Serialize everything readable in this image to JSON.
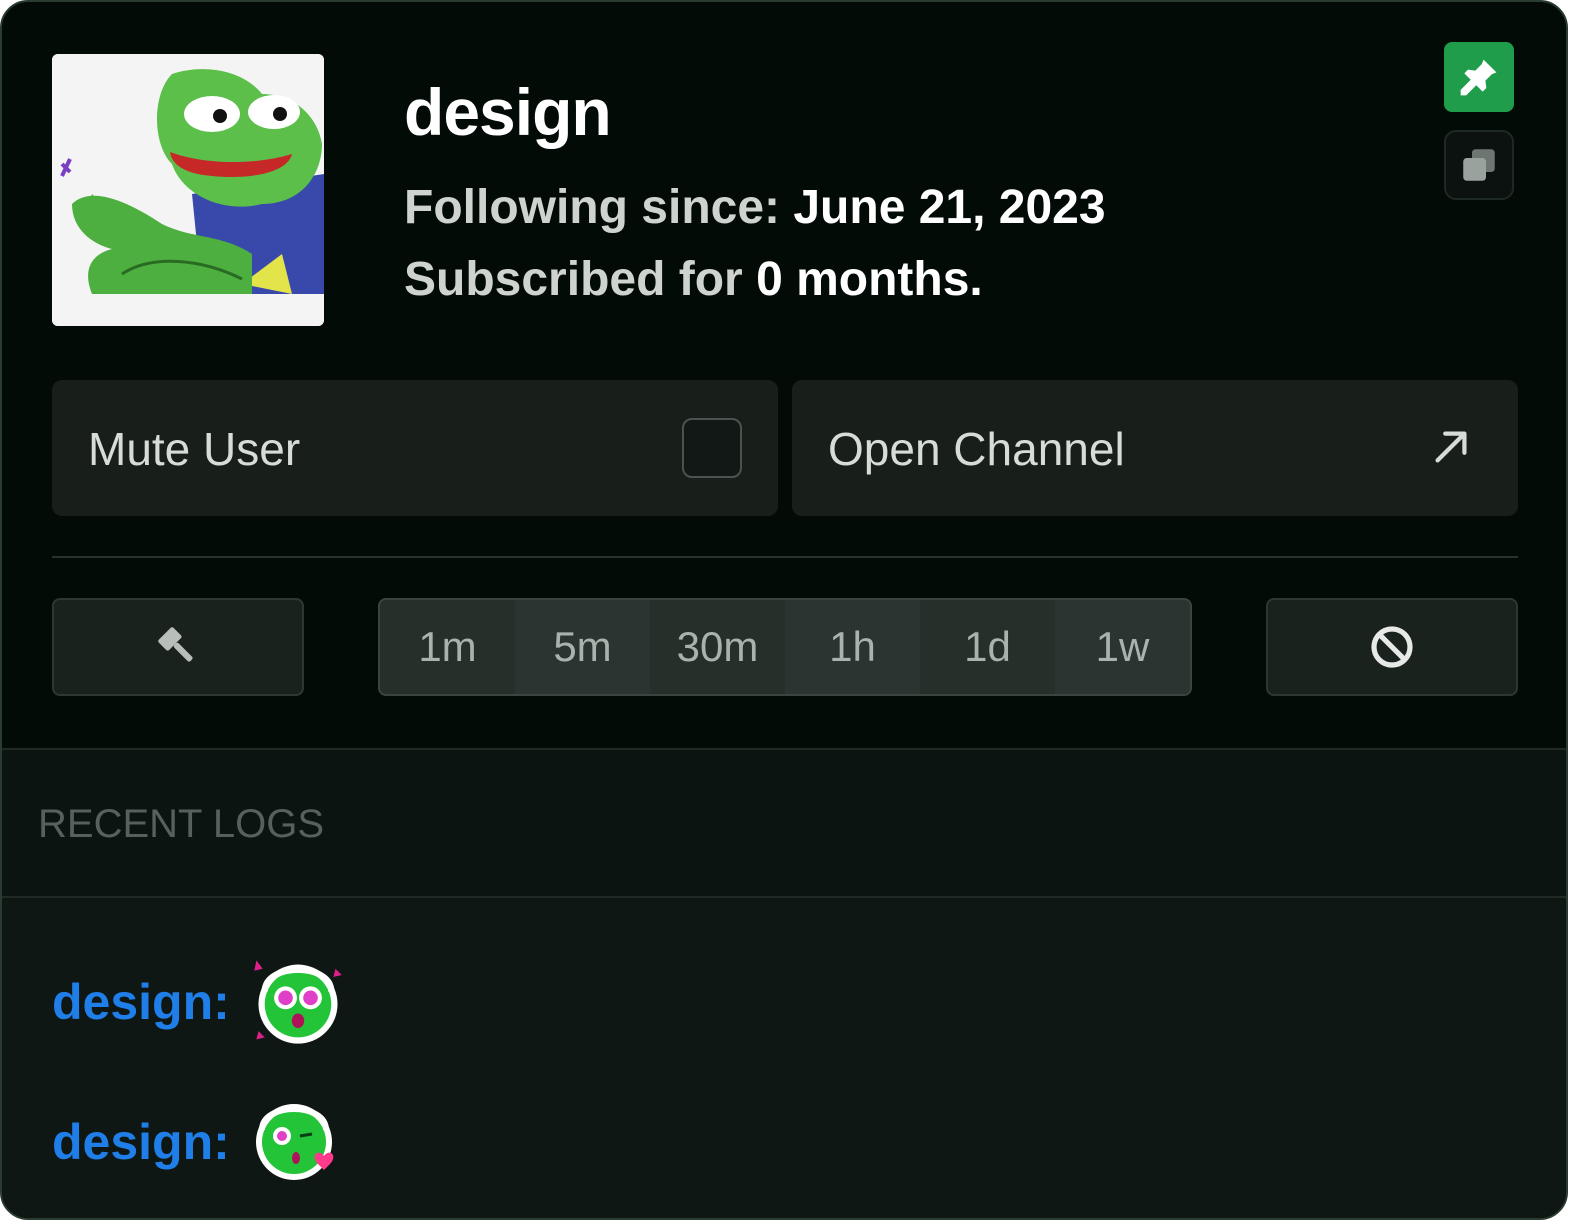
{
  "user": {
    "name": "design",
    "following_label": "Following since:",
    "following_date": "June 21, 2023",
    "subscribed_prefix": "Subscribed for",
    "subscribed_value": "0 months."
  },
  "actions": {
    "mute_label": "Mute User",
    "open_channel_label": "Open Channel"
  },
  "timeouts": [
    "1m",
    "5m",
    "30m",
    "1h",
    "1d",
    "1w"
  ],
  "logs": {
    "title": "RECENT LOGS",
    "entries": [
      {
        "user": "design:",
        "emote": "green-blob-heart-eyes-emote"
      },
      {
        "user": "design:",
        "emote": "green-blob-kiss-emote"
      }
    ]
  },
  "colors": {
    "accent_green": "#1f9d4b",
    "username_blue": "#1f7ee8",
    "background": "#030b07"
  },
  "icons": {
    "pin": "pin-icon",
    "copy": "copy-icon",
    "external": "external-link-icon",
    "ban": "gavel-icon",
    "unban": "block-icon"
  }
}
